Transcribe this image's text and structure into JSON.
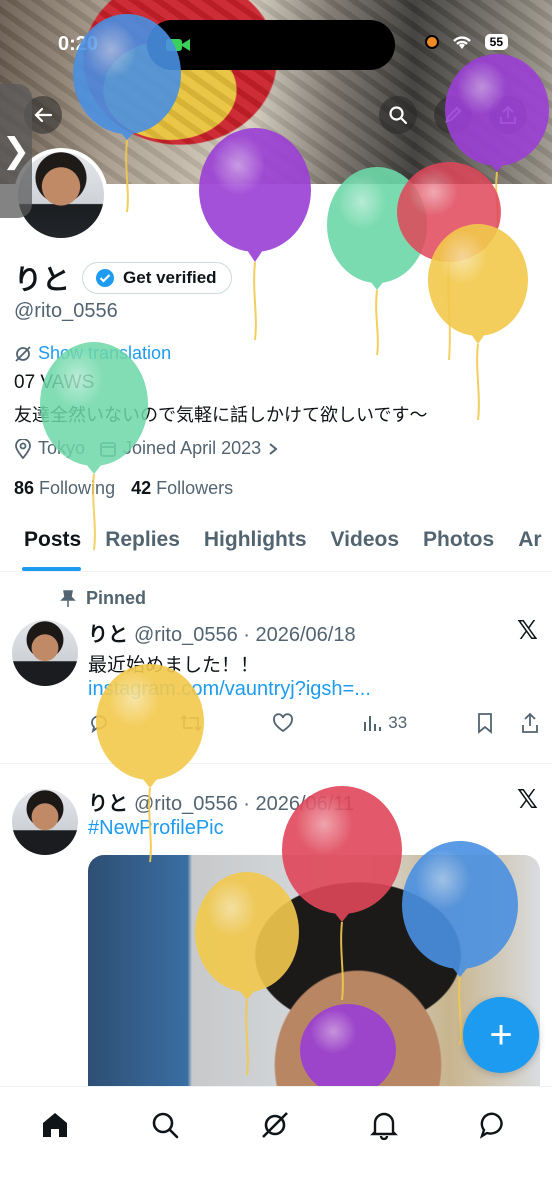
{
  "status": {
    "time": "0:20",
    "battery": "55"
  },
  "profile": {
    "display_name": "りと",
    "verify_label": "Get verified",
    "handle": "@rito_0556",
    "translate_label": "Show translation",
    "bio_line1": "07 VAWS",
    "bio_line2": "友達全然いないので気軽に話しかけて欲しいです〜",
    "location": "Tokyo",
    "joined": "Joined April 2023",
    "following_count": "86",
    "following_label": "Following",
    "followers_count": "42",
    "followers_label": "Followers"
  },
  "tabs": [
    "Posts",
    "Replies",
    "Highlights",
    "Videos",
    "Photos",
    "Ar"
  ],
  "posts": [
    {
      "pinned_label": "Pinned",
      "name": "りと",
      "meta": "@rito_0556 · 2026/06/18",
      "text": "最近始めました！！",
      "link": "instagram.com/vauntryj?igsh=...",
      "views": "33"
    },
    {
      "name": "りと",
      "meta": "@rito_0556 · 2026/06/11",
      "text": "#NewProfilePic"
    }
  ],
  "fab_label": "+",
  "colors": {
    "accent": "#1d9bf0",
    "balloon_blue": "#4a90e2",
    "balloon_purple": "#9b3fd6",
    "balloon_green": "#6dd8a8",
    "balloon_red": "#e0475a",
    "balloon_yellow": "#f2c94c"
  },
  "icons": [
    "back-arrow-icon",
    "search-icon",
    "edit-icon",
    "share-icon",
    "verified-badge-icon",
    "translate-icon",
    "location-icon",
    "calendar-icon",
    "chevron-right-icon",
    "pin-icon",
    "x-logo-icon",
    "reply-icon",
    "repost-icon",
    "like-icon",
    "views-icon",
    "bookmark-icon",
    "home-icon",
    "explore-icon",
    "grok-icon",
    "notifications-icon",
    "messages-icon"
  ]
}
